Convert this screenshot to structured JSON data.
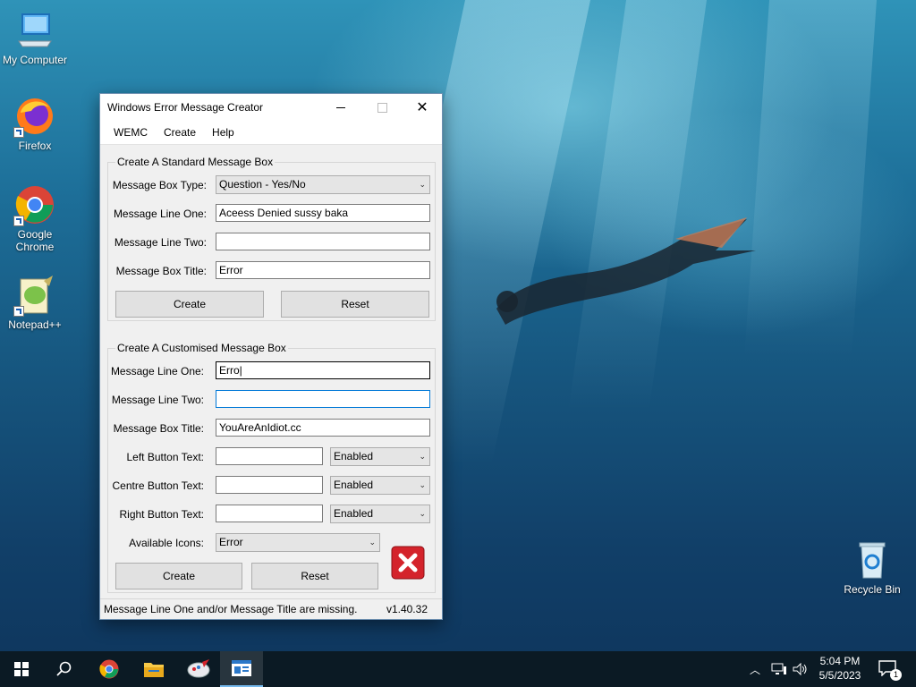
{
  "desktop": {
    "icons": [
      {
        "label": "My Computer"
      },
      {
        "label": "Firefox"
      },
      {
        "label": "Google Chrome"
      },
      {
        "label": "Notepad++"
      },
      {
        "label": "Recycle Bin"
      }
    ]
  },
  "window": {
    "title": "Windows Error Message Creator",
    "menu": [
      "WEMC",
      "Create",
      "Help"
    ],
    "standard": {
      "legend": "Create A Standard Message Box",
      "type_label": "Message Box Type:",
      "type_value": "Question - Yes/No",
      "line_one_label": "Message Line One:",
      "line_one_value": "Aceess Denied sussy baka",
      "line_two_label": "Message Line Two:",
      "line_two_value": "",
      "title_label": "Message Box Title:",
      "title_value": "Error",
      "create_label": "Create",
      "reset_label": "Reset"
    },
    "custom": {
      "legend": "Create A Customised Message Box",
      "line_one_label": "Message Line One:",
      "line_one_value": "Erro|",
      "line_two_label": "Message Line Two:",
      "line_two_value": "",
      "title_label": "Message Box Title:",
      "title_value": "YouAreAnIdiot.cc",
      "left_label": "Left Button Text:",
      "left_value": "",
      "left_state": "Enabled",
      "centre_label": "Centre Button Text:",
      "centre_value": "",
      "centre_state": "Enabled",
      "right_label": "Right Button Text:",
      "right_value": "",
      "right_state": "Enabled",
      "icons_label": "Available Icons:",
      "icons_value": "Error",
      "create_label": "Create",
      "reset_label": "Reset"
    },
    "status": {
      "message": "Message Line One and/or Message Title are missing.",
      "version": "v1.40.32"
    }
  },
  "taskbar": {
    "time": "5:04 PM",
    "date": "5/5/2023",
    "notification_count": "1"
  },
  "colors": {
    "accent": "#0078d7",
    "error_red": "#d4232b",
    "taskbar": "#0b1a24"
  }
}
